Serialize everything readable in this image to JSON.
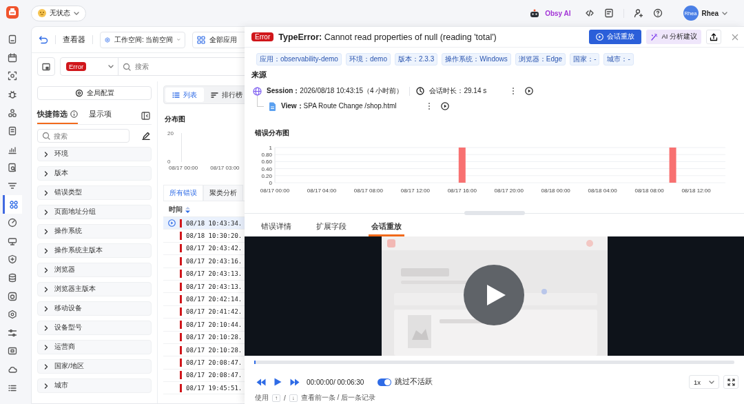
{
  "rail": {
    "items": [
      {
        "selected": false
      },
      {
        "selected": false
      },
      {
        "selected": false
      },
      {
        "selected": false
      },
      {
        "selected": false
      },
      {
        "selected": false
      },
      {
        "selected": false
      },
      {
        "selected": false
      },
      {
        "selected": false
      },
      {
        "selected": true
      },
      {
        "selected": false
      },
      {
        "selected": false
      },
      {
        "selected": false
      },
      {
        "selected": false
      },
      {
        "selected": false
      },
      {
        "selected": false
      },
      {
        "selected": false
      },
      {
        "selected": false
      },
      {
        "selected": false
      },
      {
        "selected": false
      }
    ]
  },
  "topbar": {
    "status": "无状态",
    "ai": "Obsy AI",
    "user": {
      "avatar": "Rhea",
      "name": "Rhea"
    }
  },
  "viewer": {
    "title": "查看器",
    "workspace": "工作空间: 当前空间",
    "apps": "全部应用",
    "level_filter": "Error",
    "search_placeholder": "搜索"
  },
  "filters": {
    "global_button": "全局配置",
    "tabs": [
      {
        "label": "快捷筛选",
        "selected": true
      },
      {
        "label": "显示项",
        "selected": false
      }
    ],
    "search_placeholder": "搜索",
    "items": [
      {
        "label": "环境",
        "expanded": false
      },
      {
        "label": "版本",
        "expanded": false
      },
      {
        "label": "错误类型",
        "expanded": false
      },
      {
        "label": "页面地址分组",
        "expanded": false
      },
      {
        "label": "操作系统",
        "expanded": false
      },
      {
        "label": "操作系统主版本",
        "expanded": false
      },
      {
        "label": "浏览器",
        "expanded": false
      },
      {
        "label": "浏览器主版本",
        "expanded": false
      },
      {
        "label": "移动设备",
        "expanded": false
      },
      {
        "label": "设备型号",
        "expanded": false
      },
      {
        "label": "运营商",
        "expanded": false
      },
      {
        "label": "国家/地区",
        "expanded": false
      },
      {
        "label": "城市",
        "expanded": false
      }
    ]
  },
  "results": {
    "views": [
      {
        "label": "列表",
        "selected": true
      },
      {
        "label": "排行榜",
        "selected": false
      }
    ],
    "mini_chart": {
      "title": "分布图",
      "y_labels": [
        "20",
        "0"
      ],
      "x_labels": [
        "08/17 00:00",
        "08/17 03:00"
      ]
    },
    "tabs": [
      {
        "label": "所有错误",
        "selected": true
      },
      {
        "label": "聚类分析",
        "selected": false
      }
    ],
    "column": "时间",
    "rows": [
      {
        "time": "08/18 10:43:34.",
        "selected": true
      },
      {
        "time": "08/18 10:30:20.",
        "selected": false
      },
      {
        "time": "08/17 20:43:42.",
        "selected": false
      },
      {
        "time": "08/17 20:43:16.",
        "selected": false
      },
      {
        "time": "08/17 20:43:13.",
        "selected": false
      },
      {
        "time": "08/17 20:43:13.",
        "selected": false
      },
      {
        "time": "08/17 20:42:14.",
        "selected": false
      },
      {
        "time": "08/17 20:41:42.",
        "selected": false
      },
      {
        "time": "08/17 20:10:44.",
        "selected": false
      },
      {
        "time": "08/17 20:10:28.",
        "selected": false
      },
      {
        "time": "08/17 20:10:28.",
        "selected": false
      },
      {
        "time": "08/17 20:08:47.",
        "selected": false
      },
      {
        "time": "08/17 20:08:47.",
        "selected": false
      },
      {
        "time": "08/17 19:45:51.",
        "selected": false
      }
    ]
  },
  "drawer": {
    "badge": "Error",
    "message": "**TypeError:** Cannot read properties of null (reading 'total')",
    "actions": [
      {
        "kind": "primary",
        "label": "会话重放"
      },
      {
        "kind": "ai",
        "label": "AI 分析建议"
      }
    ],
    "tags": [
      "应用：observability-demo",
      "环境：demo",
      "版本：2.3.3",
      "操作系统：Windows",
      "浏览器：Edge",
      "国家：-",
      "城市：-"
    ],
    "source": {
      "title": "来源",
      "session": "**Session：**2026/08/18 10:43:15（4 小时前）",
      "duration": "会话时长：29.14 s",
      "view": "**View：**SPA Route Change /shop.html"
    },
    "error_chart": {
      "chart_data": {
        "type": "bar",
        "title": "错误分布图",
        "categories": [
          "08/17 00:00",
          null,
          null,
          null,
          "08/17 04:00",
          null,
          null,
          null,
          "08/17 08:00",
          null,
          null,
          null,
          "08/17 12:00",
          null,
          null,
          null,
          "08/17 16:00",
          null,
          null,
          null,
          "08/17 20:00",
          null,
          null,
          null,
          "08/18 00:00",
          null,
          null,
          null,
          "08/18 04:00",
          null,
          null,
          null,
          "08/18 08:00",
          null,
          null,
          null,
          "08/18 12:00",
          null,
          null
        ],
        "series": [
          {
            "color": "#f87171",
            "values": [
              0,
              0,
              0,
              0,
              0,
              0,
              0,
              0,
              0,
              0,
              0,
              0,
              0,
              0,
              0,
              0,
              1,
              0,
              0,
              0,
              0,
              0,
              0,
              0,
              0,
              0,
              0,
              0,
              0,
              0,
              0,
              0,
              0,
              0,
              1,
              0,
              0,
              0,
              0
            ]
          }
        ],
        "ylim": [
          0,
          1
        ],
        "grid": true,
        "yticks": [
          {
            "value": 0,
            "label": "0"
          },
          {
            "value": 0.2,
            "label": "0.20"
          },
          {
            "value": 0.4,
            "label": "0.40"
          },
          {
            "value": 0.6,
            "label": "0.60"
          },
          {
            "value": 0.8,
            "label": "0.80"
          },
          {
            "value": 1,
            "label": "1"
          }
        ]
      }
    },
    "tabs": [
      {
        "label": "错误详情",
        "selected": false
      },
      {
        "label": "扩展字段",
        "selected": false
      },
      {
        "label": "会话重放",
        "selected": true
      }
    ],
    "replay": {
      "progress": {
        "level": 0.003
      },
      "time": "00:00:00/ 00:06:30",
      "skip_inactive": {
        "label": "跳过不活跃",
        "on": true
      },
      "speed": "1x",
      "hint": {
        "prefix": "使用",
        "keys": [
          "↑",
          "↓"
        ],
        "separator": "/",
        "suffix": "查看前一条 / 后一条记录"
      }
    }
  }
}
